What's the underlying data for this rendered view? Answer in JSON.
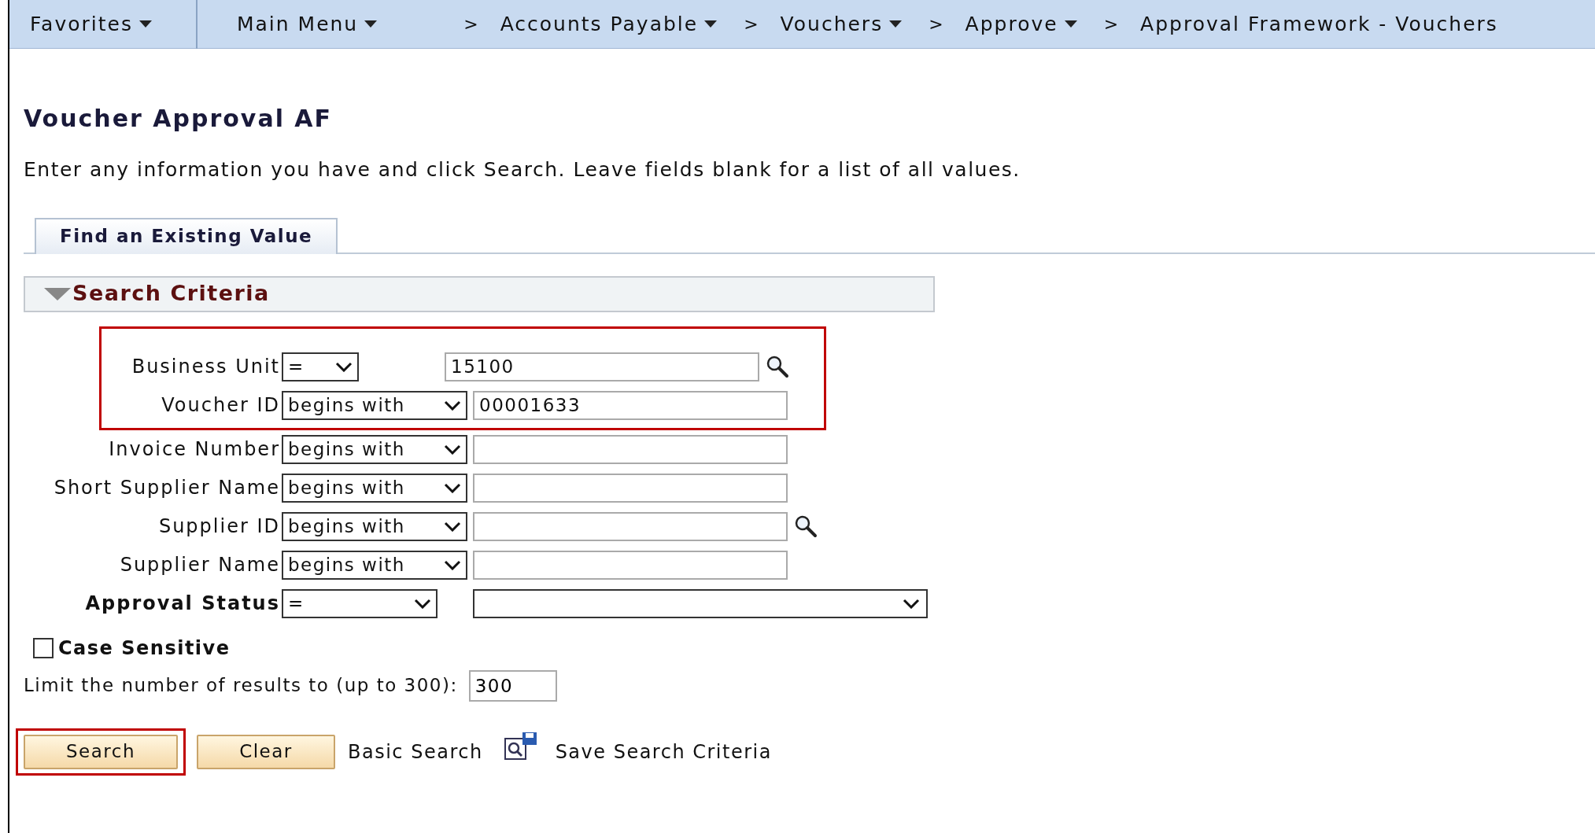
{
  "nav": {
    "items": [
      {
        "label": "Favorites",
        "dropdown": true
      },
      {
        "label": "Main Menu",
        "dropdown": true
      },
      {
        "label": "Accounts Payable",
        "dropdown": true
      },
      {
        "label": "Vouchers",
        "dropdown": true
      },
      {
        "label": "Approve",
        "dropdown": true
      },
      {
        "label": "Approval Framework - Vouchers",
        "dropdown": false
      }
    ],
    "separator": ">"
  },
  "page": {
    "title": "Voucher Approval AF",
    "instructions": "Enter any information you have and click Search. Leave fields blank for a list of all values."
  },
  "tabs": [
    {
      "label": "Find an Existing Value",
      "selected": true
    }
  ],
  "section": {
    "title": "Search Criteria",
    "expanded": true
  },
  "criteria": [
    {
      "kind": "key",
      "label": "Business Unit",
      "bold": false,
      "operator": "=",
      "value": "15100",
      "lookup": true,
      "highlighted": true
    },
    {
      "kind": "text",
      "label": "Voucher ID",
      "bold": false,
      "operator": "begins with",
      "value": "00001633",
      "lookup": false,
      "highlighted": true
    },
    {
      "kind": "text",
      "label": "Invoice Number",
      "bold": false,
      "operator": "begins with",
      "lookup": false,
      "highlighted": false
    },
    {
      "kind": "text",
      "label": "Short Supplier Name",
      "bold": false,
      "operator": "begins with",
      "lookup": false,
      "highlighted": false
    },
    {
      "kind": "text",
      "label": "Supplier ID",
      "bold": false,
      "operator": "begins with",
      "lookup": true,
      "highlighted": false
    },
    {
      "kind": "text",
      "label": "Supplier Name",
      "bold": false,
      "operator": "begins with",
      "lookup": false,
      "highlighted": false
    },
    {
      "kind": "select",
      "label": "Approval Status",
      "bold": true,
      "operator": "=",
      "lookup": false,
      "highlighted": false
    }
  ],
  "case_sensitive": {
    "label": "Case Sensitive",
    "checked": false
  },
  "limit": {
    "label": "Limit the number of results to (up to 300):",
    "value": "300"
  },
  "actions": [
    {
      "kind": "button",
      "label": "Search",
      "highlighted": true
    },
    {
      "kind": "button",
      "label": "Clear",
      "highlighted": false
    },
    {
      "kind": "link",
      "label": "Basic Search"
    },
    {
      "kind": "icon-link",
      "label": "Save Search Criteria"
    }
  ]
}
